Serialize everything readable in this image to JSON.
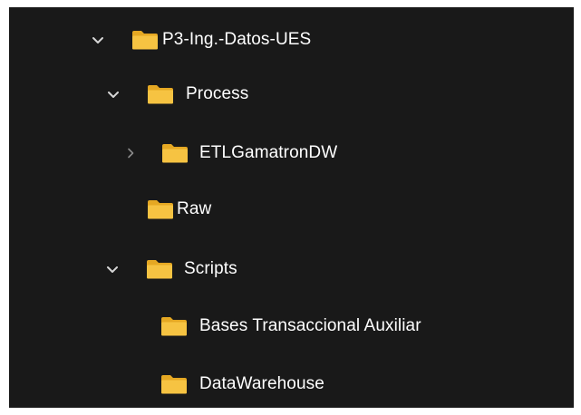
{
  "tree": {
    "items": [
      {
        "label": "P3-Ing.-Datos-UES",
        "chevron": "expanded",
        "icon": "folder-icon"
      },
      {
        "label": "Process",
        "chevron": "expanded",
        "icon": "folder-icon"
      },
      {
        "label": "ETLGamatronDW",
        "chevron": "collapsed",
        "icon": "folder-icon"
      },
      {
        "label": "Raw",
        "chevron": "none",
        "icon": "folder-icon"
      },
      {
        "label": "Scripts",
        "chevron": "expanded",
        "icon": "folder-icon"
      },
      {
        "label": "Bases Transaccional Auxiliar",
        "chevron": "none",
        "icon": "folder-icon"
      },
      {
        "label": "DataWarehouse",
        "chevron": "none",
        "icon": "folder-icon"
      }
    ]
  },
  "colors": {
    "background": "#191919",
    "text": "#ffffff",
    "folder": "#f6c342",
    "chevron": "#d6d6d6"
  }
}
